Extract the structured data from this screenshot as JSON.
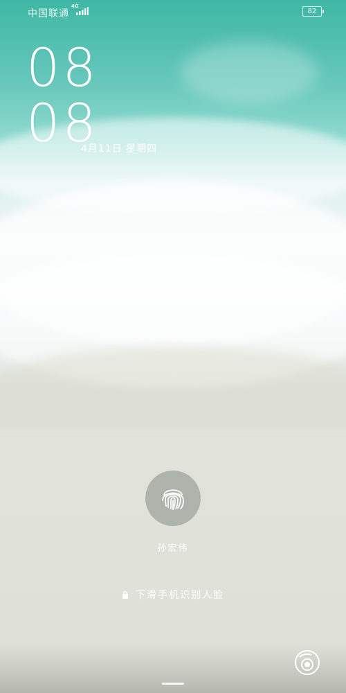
{
  "status_bar": {
    "carrier": "中国联通",
    "network_type": "4G",
    "battery_level": "82",
    "icons": [
      "signal-icon",
      "battery-icon"
    ]
  },
  "clock": {
    "hour": "08",
    "minute": "08",
    "date": "4月11日 星期四"
  },
  "fingerprint": {
    "icon": "fingerprint-icon",
    "user_name": "孙宏伟"
  },
  "unlock_hint": {
    "icon": "lock-icon",
    "text": "下滑手机识别人脸"
  },
  "bottom": {
    "camera_icon": "camera-icon"
  }
}
